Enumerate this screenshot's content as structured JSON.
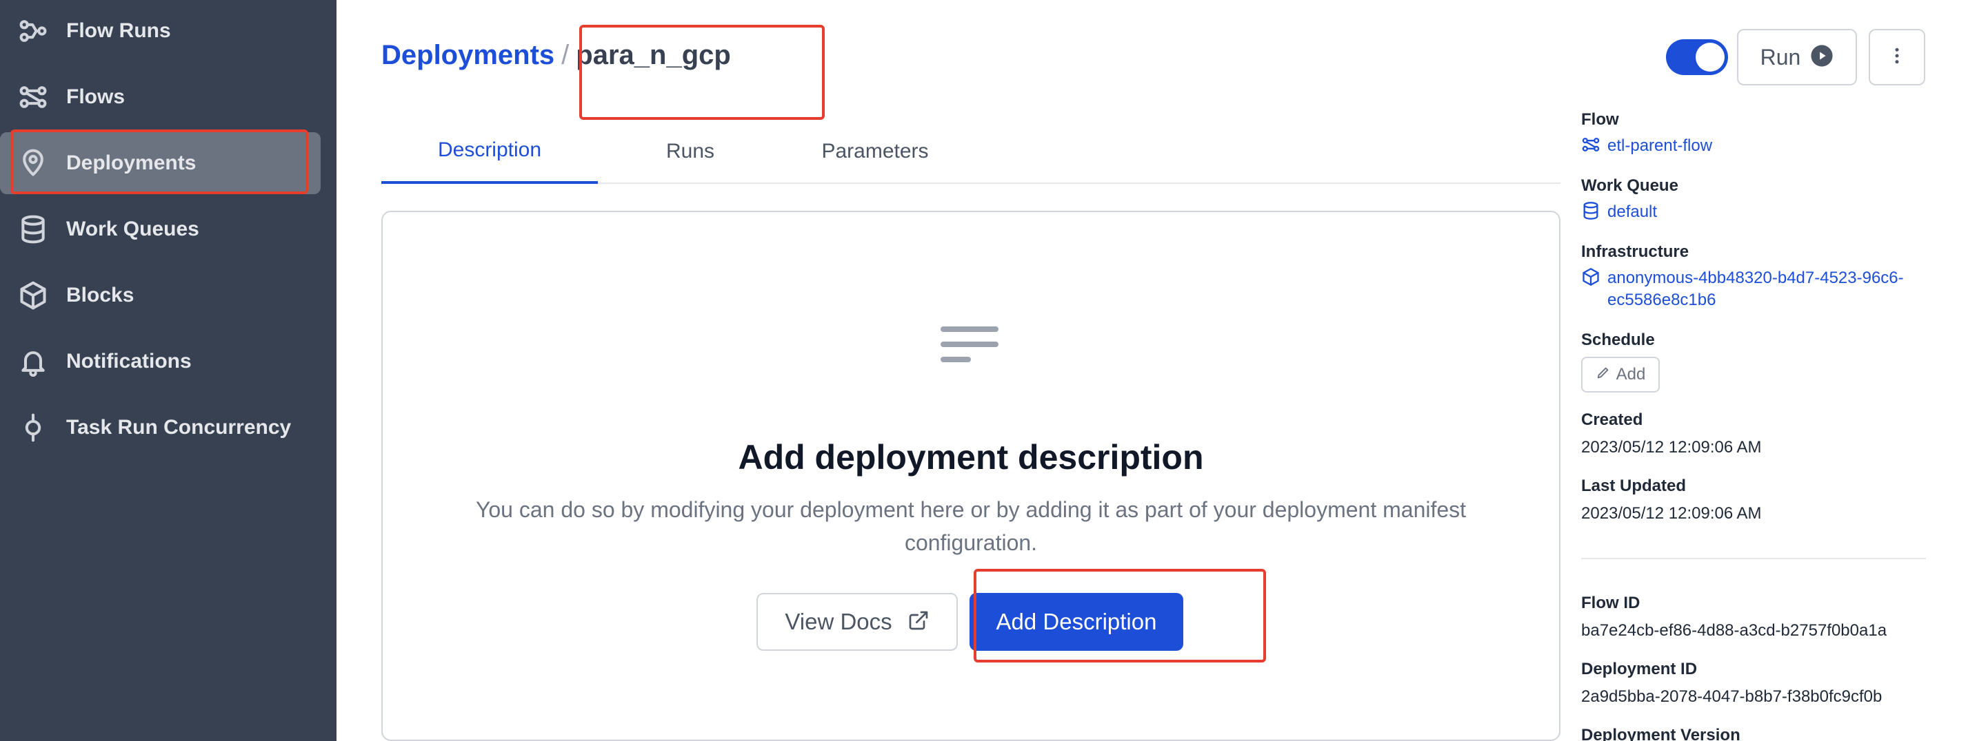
{
  "sidebar": {
    "items": [
      {
        "label": "Flow Runs",
        "icon": "flow-runs-icon"
      },
      {
        "label": "Flows",
        "icon": "flows-icon"
      },
      {
        "label": "Deployments",
        "icon": "location-pin-icon",
        "active": true
      },
      {
        "label": "Work Queues",
        "icon": "database-icon"
      },
      {
        "label": "Blocks",
        "icon": "cube-icon"
      },
      {
        "label": "Notifications",
        "icon": "bell-icon"
      },
      {
        "label": "Task Run Concurrency",
        "icon": "concurrency-icon"
      }
    ]
  },
  "header": {
    "breadcrumb_root": "Deployments",
    "separator": "/",
    "deployment_name": "para_n_gcp",
    "toggle_on": true,
    "run_label": "Run"
  },
  "tabs": [
    {
      "label": "Description",
      "active": true
    },
    {
      "label": "Runs"
    },
    {
      "label": "Parameters"
    }
  ],
  "empty_state": {
    "icon": "text-lines-icon",
    "title": "Add deployment description",
    "text": "You can do so by modifying your deployment here or by adding it as part of your deployment manifest configuration.",
    "view_docs_label": "View Docs",
    "add_description_label": "Add Description"
  },
  "details": {
    "flow_label": "Flow",
    "flow_value": "etl-parent-flow",
    "work_queue_label": "Work Queue",
    "work_queue_value": "default",
    "infrastructure_label": "Infrastructure",
    "infrastructure_value": "anonymous-4bb48320-b4d7-4523-96c6-ec5586e8c1b6",
    "schedule_label": "Schedule",
    "schedule_add_label": "Add",
    "created_label": "Created",
    "created_value": "2023/05/12 12:09:06 AM",
    "last_updated_label": "Last Updated",
    "last_updated_value": "2023/05/12 12:09:06 AM",
    "flow_id_label": "Flow ID",
    "flow_id_value": "ba7e24cb-ef86-4d88-a3cd-b2757f0b0a1a",
    "deployment_id_label": "Deployment ID",
    "deployment_id_value": "2a9d5bba-2078-4047-b8b7-f38b0fc9cf0b",
    "deployment_version_label": "Deployment Version"
  },
  "colors": {
    "sidebar_bg": "#374151",
    "accent": "#1d4ed8",
    "annotation": "#e53e2f"
  }
}
